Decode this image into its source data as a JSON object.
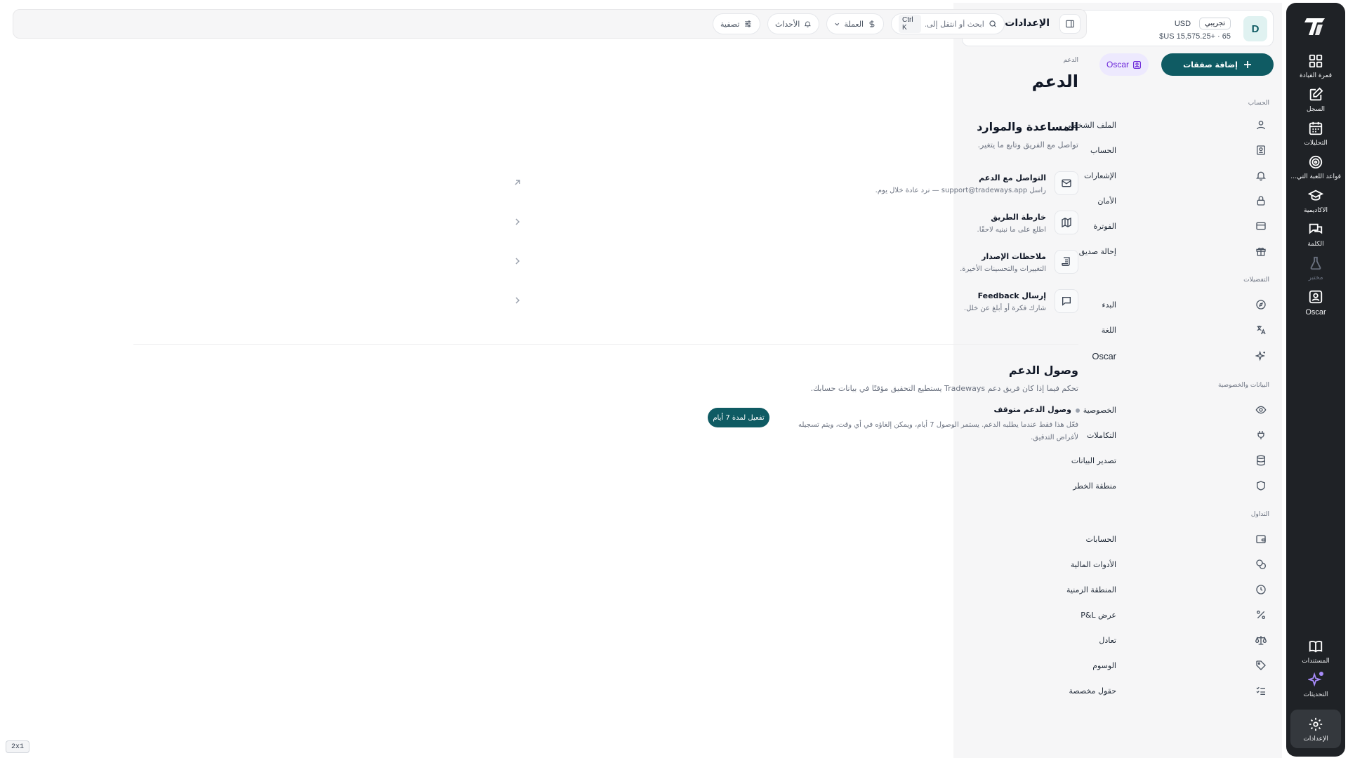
{
  "rail": {
    "items": [
      {
        "label": "قمرة القيادة",
        "icon": "dashboard-icon"
      },
      {
        "label": "السجل",
        "icon": "journal-icon"
      },
      {
        "label": "التحليلات",
        "icon": "calendar-icon"
      },
      {
        "label": "قواعد اللعبة التي تمارسها",
        "icon": "target-icon"
      },
      {
        "label": "الأكاديمية",
        "icon": "academy-icon"
      },
      {
        "label": "الكلمة",
        "icon": "chat-icon"
      },
      {
        "label": "مختبر",
        "icon": "lab-icon"
      },
      {
        "label": "Oscar",
        "icon": "oscar-icon"
      }
    ],
    "bottom": [
      {
        "label": "المستندات",
        "icon": "book-icon"
      },
      {
        "label": "التحديثات",
        "icon": "sparkle-icon"
      },
      {
        "label": "الإعدادات",
        "icon": "gear-icon"
      }
    ]
  },
  "account": {
    "avatar_initial": "D",
    "currency": "USD",
    "badge": "تجريبي",
    "balance": "$US 15,575.25+ · 65"
  },
  "sidebar": {
    "add_trades_label": "إضافة صفقات",
    "oscar_label": "Oscar",
    "sections": [
      {
        "title": "الحساب",
        "items": [
          {
            "label": "الملف الشخصي",
            "icon": "user-icon"
          },
          {
            "label": "الحساب",
            "icon": "id-card-icon"
          },
          {
            "label": "الإشعارات",
            "icon": "bell-icon"
          },
          {
            "label": "الأمان",
            "icon": "lock-icon"
          },
          {
            "label": "الفوترة",
            "icon": "credit-card-icon"
          },
          {
            "label": "إحالة صديق",
            "icon": "gift-icon"
          }
        ]
      },
      {
        "title": "التفضيلات",
        "items": [
          {
            "label": "البدء",
            "icon": "compass-icon"
          },
          {
            "label": "اللغة",
            "icon": "language-icon"
          },
          {
            "label": "Oscar",
            "icon": "sparkles-icon"
          }
        ]
      },
      {
        "title": "البيانات والخصوصية",
        "items": [
          {
            "label": "الخصوصية",
            "icon": "eye-icon"
          },
          {
            "label": "التكاملات",
            "icon": "plug-icon"
          },
          {
            "label": "تصدير البيانات",
            "icon": "database-icon"
          },
          {
            "label": "منطقة الخطر",
            "icon": "shield-icon"
          }
        ]
      },
      {
        "title": "التداول",
        "items": [
          {
            "label": "الحسابات",
            "icon": "wallet-icon"
          },
          {
            "label": "الأدوات المالية",
            "icon": "coins-icon"
          },
          {
            "label": "المنطقة الزمنية",
            "icon": "clock-icon"
          },
          {
            "label": "عرض P&L",
            "icon": "percent-icon"
          },
          {
            "label": "تعادل",
            "icon": "scale-icon"
          },
          {
            "label": "الوسوم",
            "icon": "tag-icon"
          },
          {
            "label": "حقول مخصصة",
            "icon": "list-check-icon"
          }
        ]
      }
    ]
  },
  "topbar": {
    "title": "الإعدادات",
    "search_placeholder": "ابحث أو انتقل إلى...",
    "search_shortcut": "Ctrl K",
    "currency_label": "العملة",
    "events_label": "الأحداث",
    "filter_label": "تصفية"
  },
  "main": {
    "breadcrumb": "الدعم",
    "title": "الدعم",
    "help": {
      "heading": "المساعدة والموارد",
      "subtitle": "تواصل مع الفريق وتابع ما يتغير.",
      "items": [
        {
          "title": "التواصل مع الدعم",
          "desc": "راسل support@tradeways.app — نرد عادة خلال يوم.",
          "icon": "mail-icon",
          "arrow": "external-link-icon"
        },
        {
          "title": "خارطة الطريق",
          "desc": "اطلع على ما نبنيه لاحقًا.",
          "icon": "map-icon",
          "arrow": "chevron-icon"
        },
        {
          "title": "ملاحظات الإصدار",
          "desc": "التغييرات والتحسينات الأخيرة.",
          "icon": "scroll-icon",
          "arrow": "chevron-icon"
        },
        {
          "title": "إرسال Feedback",
          "desc": "شارك فكرة أو أبلغ عن خلل.",
          "icon": "message-icon",
          "arrow": "chevron-icon"
        }
      ]
    },
    "access": {
      "heading": "وصول الدعم",
      "subtitle": "تحكم فيما إذا كان فريق دعم Tradeways يستطيع التحقيق مؤقتًا في بيانات حسابك.",
      "status_title": "وصول الدعم متوقف",
      "status_desc": "فعّل هذا فقط عندما يطلبه الدعم. يستمر الوصول 7 أيام، ويمكن إلغاؤه في أي وقت، ويتم تسجيله لأغراض التدقيق.",
      "enable_label": "تفعيل لمدة 7 أيام"
    }
  },
  "zoom_tag": "2x1",
  "colors": {
    "accent": "#0f5b63",
    "rail_bg": "#1f2226",
    "oscar_bg": "#ede9fe",
    "oscar_text": "#6d28d9"
  }
}
